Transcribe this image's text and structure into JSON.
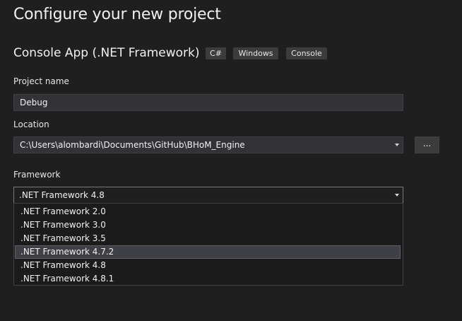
{
  "page": {
    "title": "Configure your new project"
  },
  "template": {
    "name": "Console App (.NET Framework)",
    "tags": [
      "C#",
      "Windows",
      "Console"
    ]
  },
  "project_name": {
    "label": "Project name",
    "value": "Debug"
  },
  "location": {
    "label": "Location",
    "value": "C:\\Users\\alombardi\\Documents\\GitHub\\BHoM_Engine",
    "browse_label": "..."
  },
  "framework": {
    "label": "Framework",
    "selected": ".NET Framework 4.8",
    "hovered": ".NET Framework 4.7.2",
    "options": [
      ".NET Framework 2.0",
      ".NET Framework 3.0",
      ".NET Framework 3.5",
      ".NET Framework 4.7.2",
      ".NET Framework 4.8",
      ".NET Framework 4.8.1"
    ]
  },
  "colors": {
    "background": "#1f1f1f",
    "input_background": "#333337",
    "tag_background": "#3c3c3c",
    "highlight": "#3f3f46"
  },
  "icons": {
    "dropdown": "chevron-down-icon"
  }
}
